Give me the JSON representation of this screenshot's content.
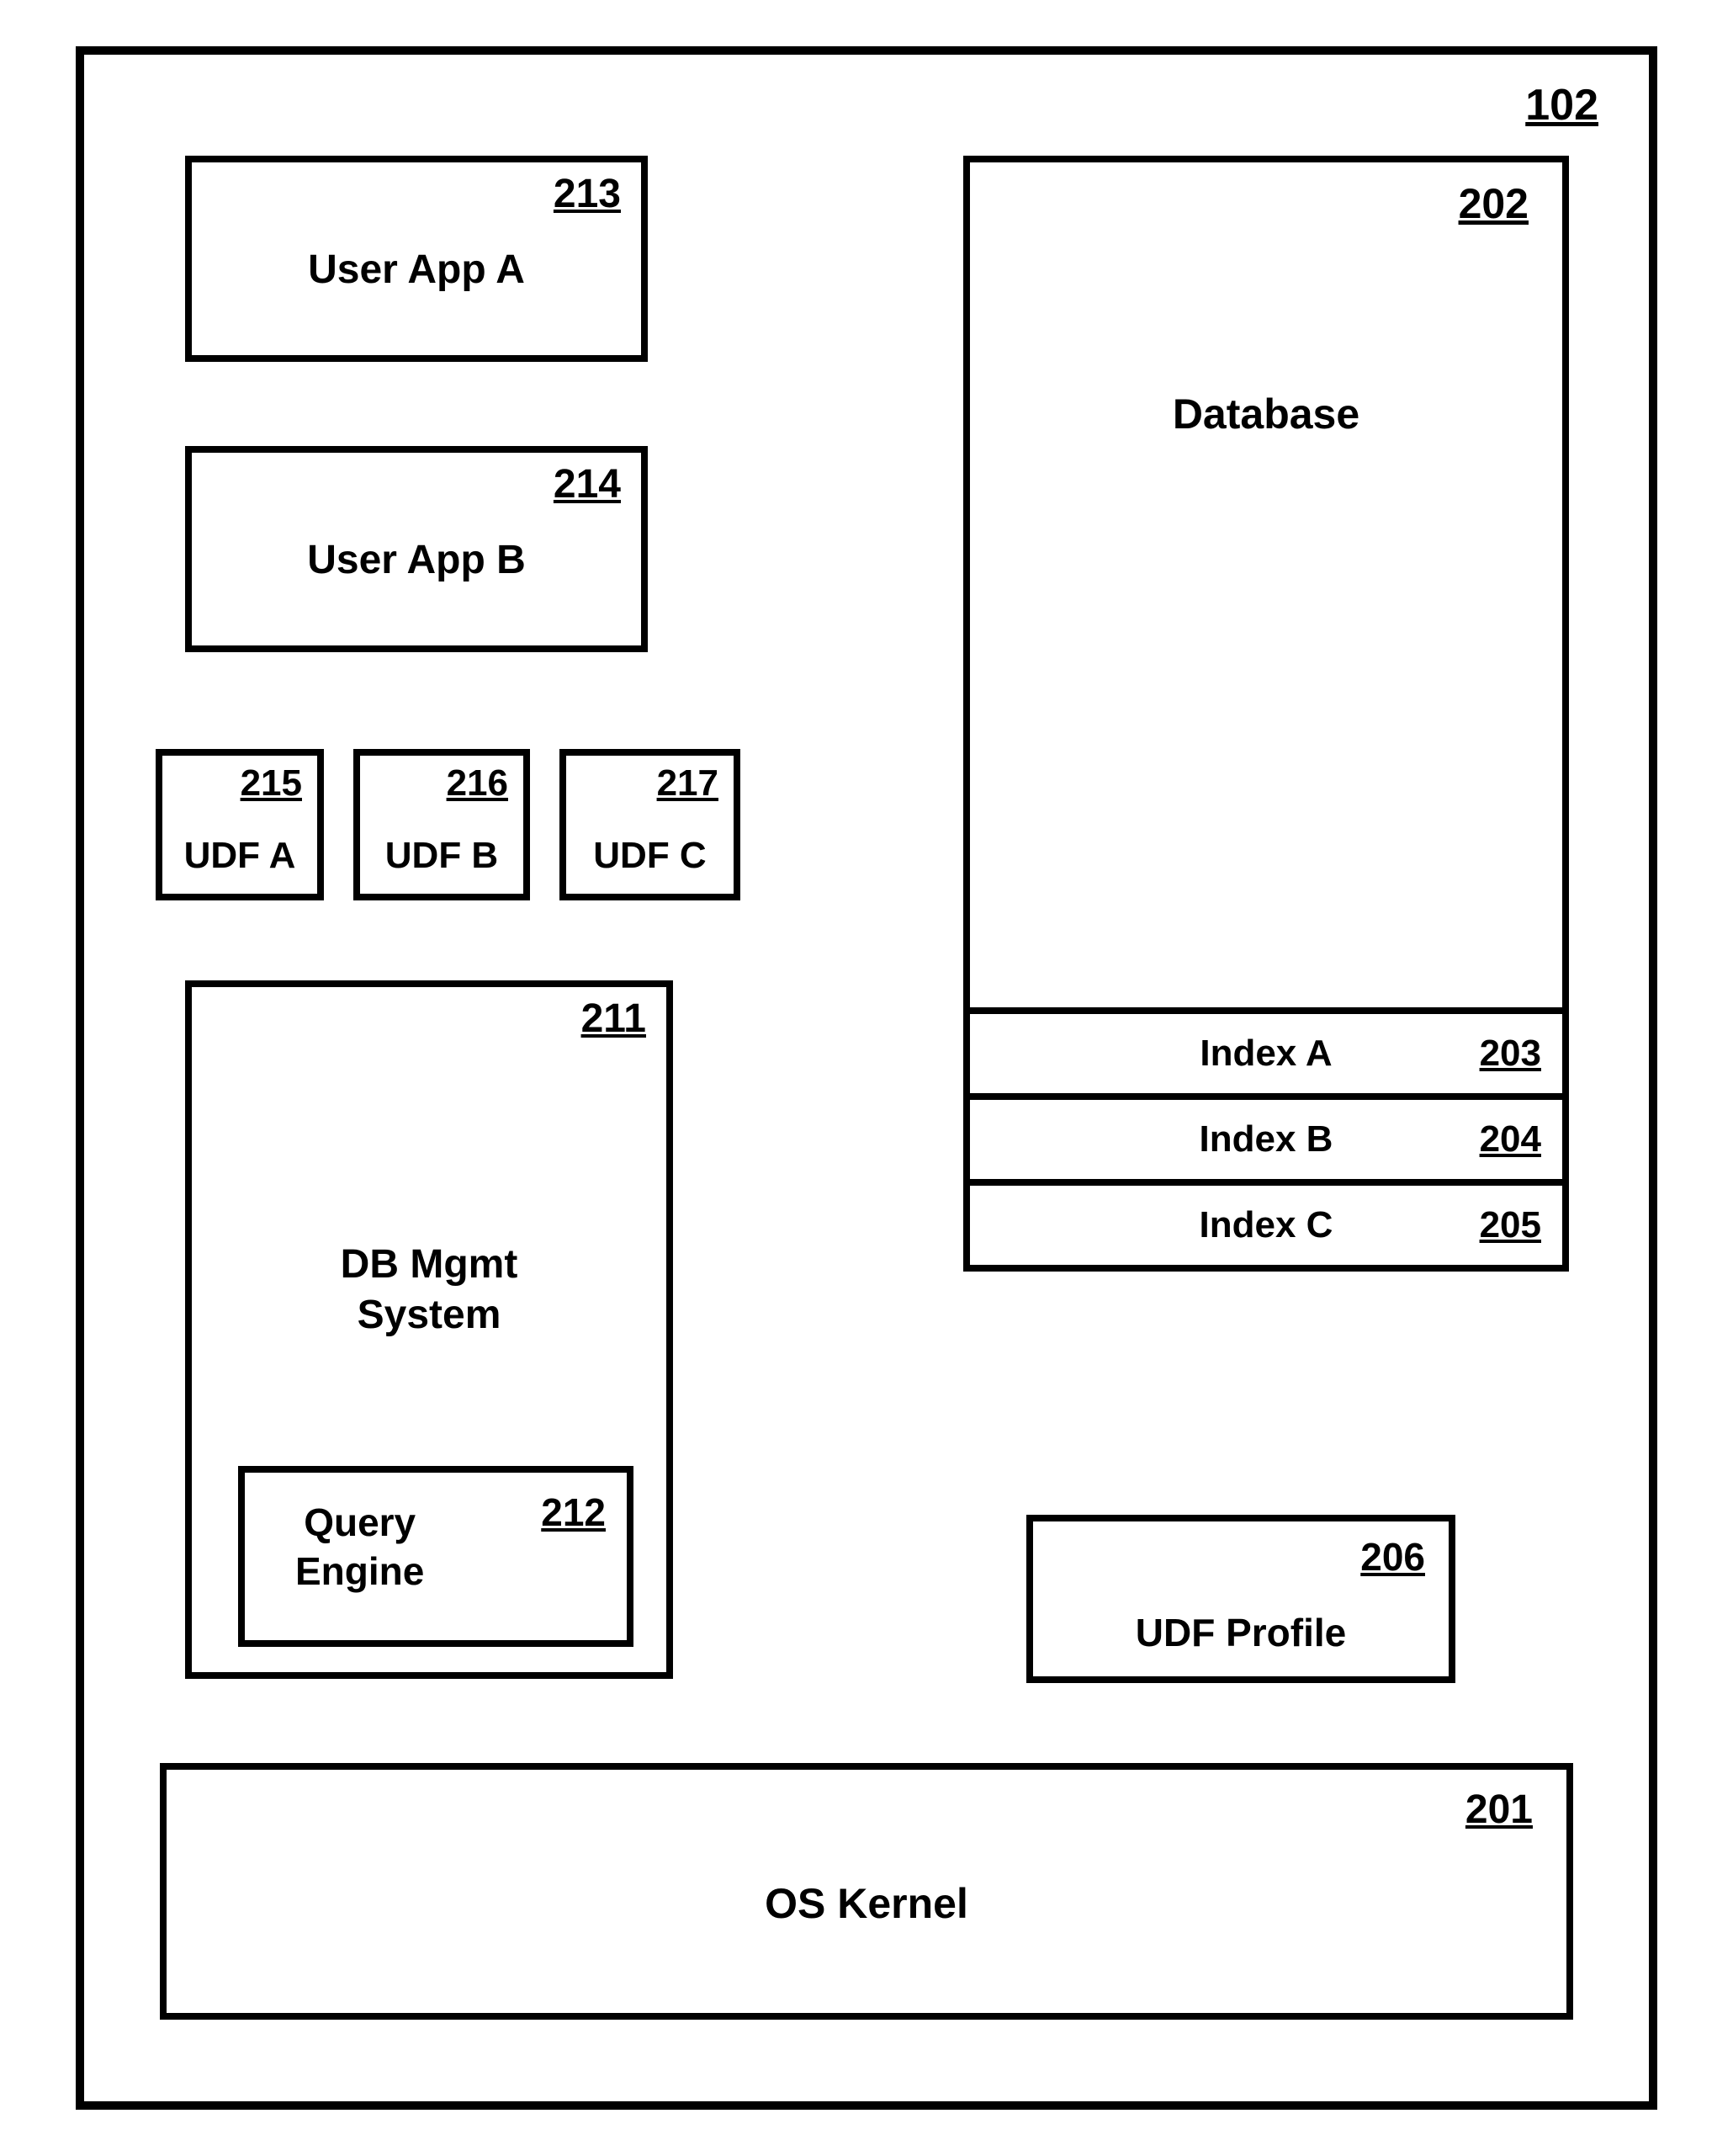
{
  "outer": {
    "ref": "102"
  },
  "user_app_a": {
    "ref": "213",
    "label": "User App A"
  },
  "user_app_b": {
    "ref": "214",
    "label": "User App B"
  },
  "udf_a": {
    "ref": "215",
    "label": "UDF A"
  },
  "udf_b": {
    "ref": "216",
    "label": "UDF B"
  },
  "udf_c": {
    "ref": "217",
    "label": "UDF C"
  },
  "db_mgmt": {
    "ref": "211",
    "label": "DB Mgmt\nSystem"
  },
  "query_engine": {
    "ref": "212",
    "label": "Query\nEngine"
  },
  "database": {
    "ref": "202",
    "label": "Database"
  },
  "index_a": {
    "ref": "203",
    "label": "Index A"
  },
  "index_b": {
    "ref": "204",
    "label": "Index B"
  },
  "index_c": {
    "ref": "205",
    "label": "Index C"
  },
  "udf_profile": {
    "ref": "206",
    "label": "UDF Profile"
  },
  "os_kernel": {
    "ref": "201",
    "label": "OS Kernel"
  }
}
